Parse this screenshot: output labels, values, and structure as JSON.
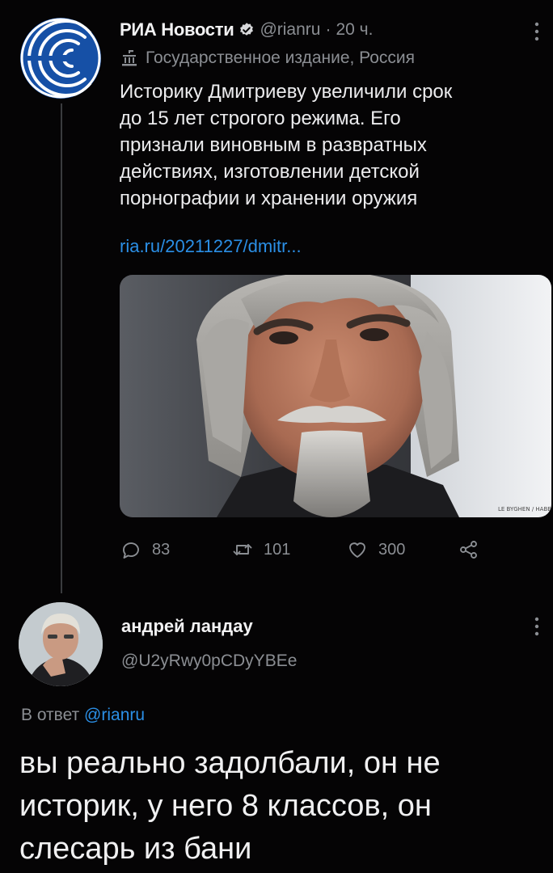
{
  "tweet": {
    "author_name": "РИА Новости",
    "handle": "@rianru",
    "separator": "·",
    "time": "20 ч.",
    "label": "Государственное издание, Россия",
    "text_lines": [
      "Историку Дмитриеву увеличили срок",
      "до 15 лет строгого режима. Его",
      "признали виновным в развратных",
      "действиях, изготовлении детской",
      "порнографии и хранении оружия"
    ],
    "link": "ria.ru/20211227/dmitr...",
    "media": {
      "watermark": "LE BYGHEN / HABEMUS"
    },
    "stats": {
      "replies": "83",
      "retweets": "101",
      "likes": "300"
    }
  },
  "reply": {
    "author_name": "андрей ландау",
    "handle": "@U2yRwy0pCDyYBEe",
    "reply_prefix": "В ответ",
    "reply_mention": "@rianru",
    "text_lines": [
      "вы реально задолбали, он не",
      "историк, у него 8 классов, он",
      "слесарь из бани"
    ]
  },
  "icons": {
    "verified": "verified-badge-icon",
    "government": "government-building-icon",
    "more": "more-vertical-icon",
    "reply": "reply-icon",
    "retweet": "retweet-icon",
    "like": "heart-icon",
    "share": "share-icon"
  },
  "colors": {
    "background": "#050405",
    "link": "#2b8fe6",
    "muted": "#8b8e93",
    "ria_blue": "#1650a6"
  }
}
